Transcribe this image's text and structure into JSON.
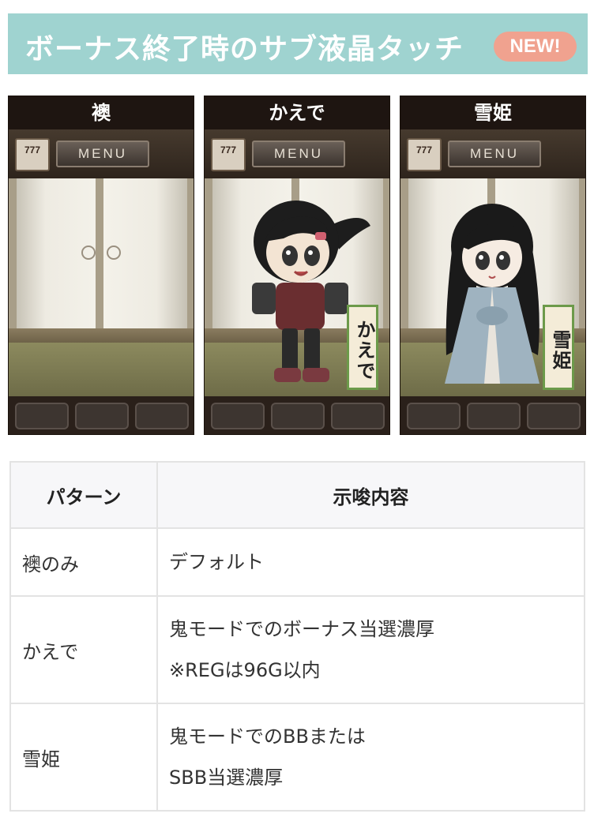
{
  "header": {
    "title": "ボーナス終了時のサブ液晶タッチ",
    "badge": "NEW!",
    "bg_color": "#9fd3d0",
    "badge_color": "#f0a28f"
  },
  "panels": [
    {
      "title": "襖",
      "menu_label": "MENU",
      "slot_label": "777",
      "character": "none"
    },
    {
      "title": "かえで",
      "menu_label": "MENU",
      "slot_label": "777",
      "character": "kaede",
      "tag": "かえで"
    },
    {
      "title": "雪姫",
      "menu_label": "MENU",
      "slot_label": "777",
      "character": "yukihime",
      "tag": "雪姫"
    }
  ],
  "table": {
    "headers": [
      "パターン",
      "示唆内容"
    ],
    "rows": [
      {
        "pattern": "襖のみ",
        "lines": [
          "デフォルト"
        ]
      },
      {
        "pattern": "かえで",
        "lines": [
          "鬼モードでのボーナス当選濃厚",
          "※REGは96G以内"
        ]
      },
      {
        "pattern": "雪姫",
        "lines": [
          "鬼モードでのBBまたは",
          "SBB当選濃厚"
        ]
      }
    ]
  }
}
